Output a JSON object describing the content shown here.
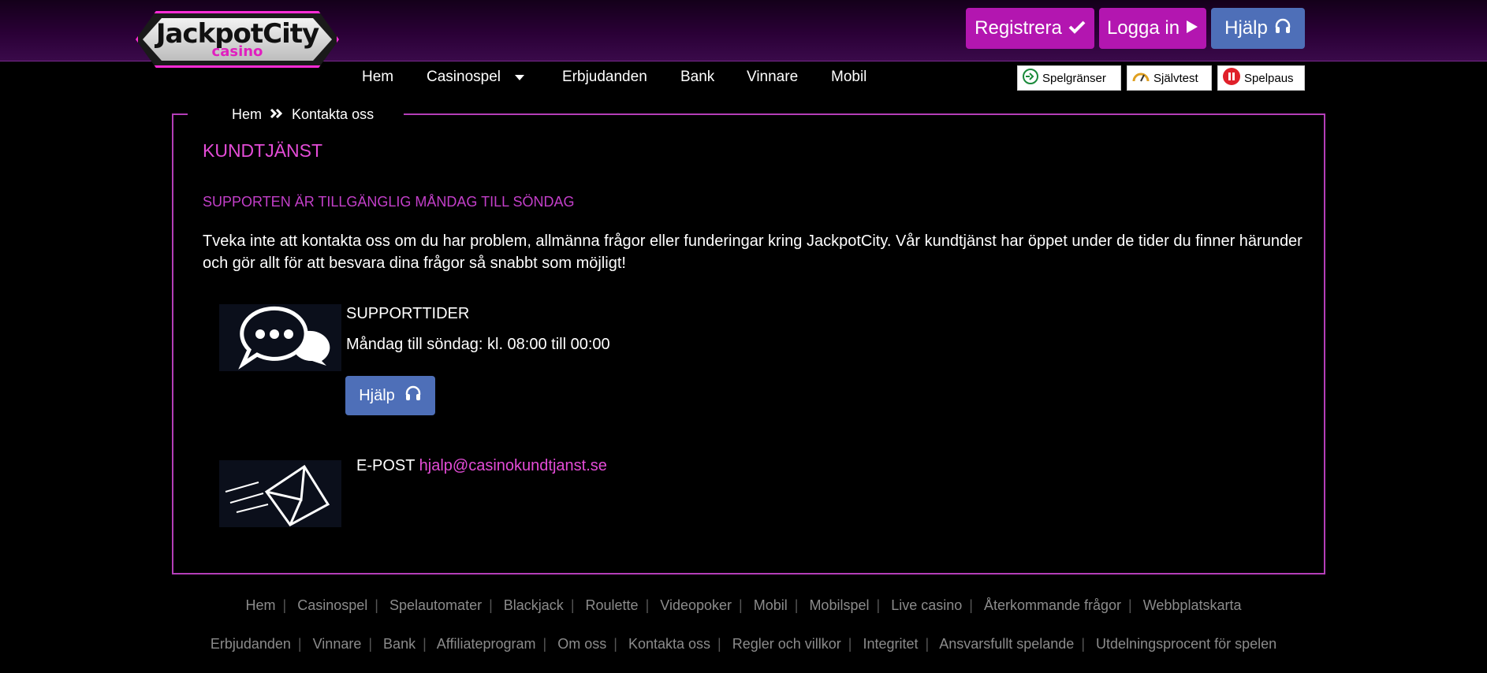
{
  "header": {
    "logo_text": "JackpotCity",
    "logo_sub": "casino",
    "register_label": "Registrera",
    "login_label": "Logga in",
    "help_label": "Hjälp"
  },
  "nav": {
    "items": [
      "Hem",
      "Casinospel",
      "Erbjudanden",
      "Bank",
      "Vinnare",
      "Mobil"
    ]
  },
  "responsible_gaming": {
    "limits": "Spelgränser",
    "selftest": "Självtest",
    "pause": "Spelpaus"
  },
  "breadcrumb": {
    "home": "Hem",
    "current": "Kontakta oss"
  },
  "main": {
    "title": "KUNDTJÄNST",
    "subtitle": "SUPPORTEN ÄR TILLGÄNGLIG MÅNDAG TILL SÖNDAG",
    "intro": "Tveka inte att kontakta oss om du har problem, allmänna frågor eller funderingar kring JackpotCity. Vår kundtjänst har öppet under de tider du finner härunder och gör allt för att besvara dina frågor så snabbt som möjligt!",
    "support_heading": "SUPPORTTIDER",
    "support_hours": "Måndag till söndag: kl. 08:00 till 00:00",
    "help_button": "Hjälp",
    "email_label": "E-POST",
    "email": "hjalp@casinokundtjanst.se"
  },
  "footer": {
    "row1": [
      "Hem",
      "Casinospel",
      "Spelautomater",
      "Blackjack",
      "Roulette",
      "Videopoker",
      "Mobil",
      "Mobilspel",
      "Live casino",
      "Återkommande frågor",
      "Webbplatskarta"
    ],
    "row2": [
      "Erbjudanden",
      "Vinnare",
      "Bank",
      "Affiliateprogram",
      "Om oss",
      "Kontakta oss",
      "Regler och villkor",
      "Integritet",
      "Ansvarsfullt spelande",
      "Utdelningsprocent för spelen"
    ]
  },
  "colors": {
    "accent_pink": "#e44cd7",
    "button_purple": "#b316b0",
    "button_blue": "#4e6fb8",
    "border": "#b43eb8"
  },
  "icons": [
    "check-icon",
    "play-icon",
    "headset-icon",
    "chat-bubbles-icon",
    "envelope-icon",
    "chevron-down-icon",
    "double-chevron-right-icon"
  ]
}
